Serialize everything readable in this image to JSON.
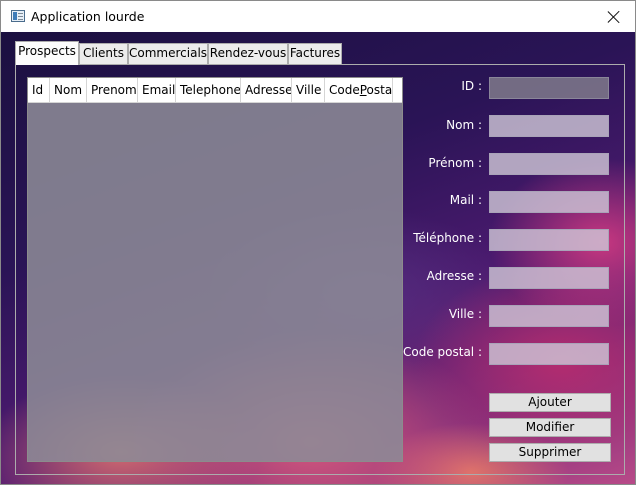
{
  "window": {
    "title": "Application lourde"
  },
  "tabs": [
    "Prospects",
    "Clients",
    "Commercials",
    "Rendez-vous",
    "Factures"
  ],
  "active_tab": "Prospects",
  "grid": {
    "columns": [
      "Id",
      "Nom",
      "Prenom",
      "Email",
      "Telephone",
      "Adresse",
      "Ville"
    ],
    "last_column": {
      "before": "Code",
      "underlined": "P",
      "after": "ostal"
    },
    "rows": []
  },
  "form": {
    "id_label": "ID :",
    "nom_label": "Nom :",
    "prenom_label": "Prénom :",
    "mail_label": "Mail :",
    "telephone_label": "Téléphone :",
    "adresse_label": "Adresse :",
    "ville_label": "Ville :",
    "code_postal_label": "Code postal :",
    "id_value": "",
    "nom_value": "",
    "prenom_value": "",
    "mail_value": "",
    "telephone_value": "",
    "adresse_value": "",
    "ville_value": "",
    "code_postal_value": ""
  },
  "buttons": {
    "add": "Ajouter",
    "edit": "Modifier",
    "delete": "Supprimer"
  }
}
